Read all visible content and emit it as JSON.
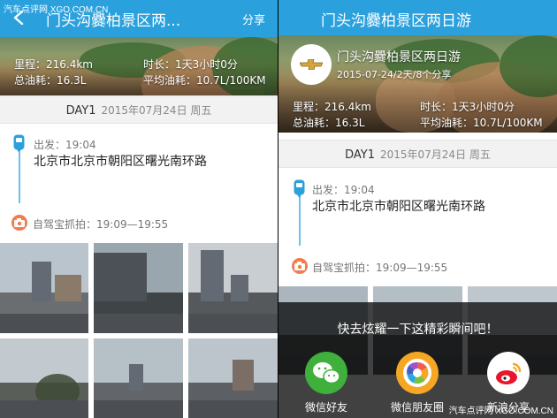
{
  "watermark": "汽车点评网 XGO.COM.CN",
  "left_panel": {
    "nav_title": "门头沟爨柏景区两...",
    "share_label": "分享",
    "stats": {
      "distance": "里程：216.4km",
      "duration": "时长：1天3小时0分",
      "fuel_total": "总油耗：16.3L",
      "fuel_avg": "平均油耗：10.7L/100KM"
    },
    "day": {
      "label": "DAY1",
      "date": "2015年07月24日 周五"
    },
    "depart": {
      "time": "出发：19:04",
      "address": "北京市北京市朝阳区曙光南环路"
    },
    "capture": {
      "text": "自驾宝抓拍：19:09—19:55"
    }
  },
  "right_panel": {
    "nav_title": "门头沟爨柏景区两日游",
    "hero": {
      "title": "门头沟爨柏景区两日游",
      "subtitle": "2015-07-24/2天/8个分享",
      "logo_icon": "chevrolet-bowtie-icon"
    },
    "stats": {
      "distance": "里程：216.4km",
      "duration": "时长：1天3小时0分",
      "fuel_total": "总油耗：16.3L",
      "fuel_avg": "平均油耗：10.7L/100KM"
    },
    "day": {
      "label": "DAY1",
      "date": "2015年07月24日 周五"
    },
    "depart": {
      "time": "出发：19:04",
      "address": "北京市北京市朝阳区曙光南环路"
    },
    "capture": {
      "text": "自驾宝抓拍：19:09—19:55"
    },
    "share_sheet": {
      "prompt": "快去炫耀一下这精彩瞬间吧！",
      "options": [
        {
          "label": "微信好友",
          "icon": "wechat-icon",
          "color": "#3fb03c"
        },
        {
          "label": "微信朋友圈",
          "icon": "wechat-moments-icon",
          "color": "#f5a623"
        },
        {
          "label": "新浪分享",
          "icon": "weibo-icon",
          "color": "#e6162d"
        }
      ],
      "watermark": "汽车点评网 XGO.COM.CN"
    }
  },
  "colors": {
    "nav": "#2aa1dd",
    "timeline": "#6cc0ea",
    "camera": "#f07d4e"
  }
}
